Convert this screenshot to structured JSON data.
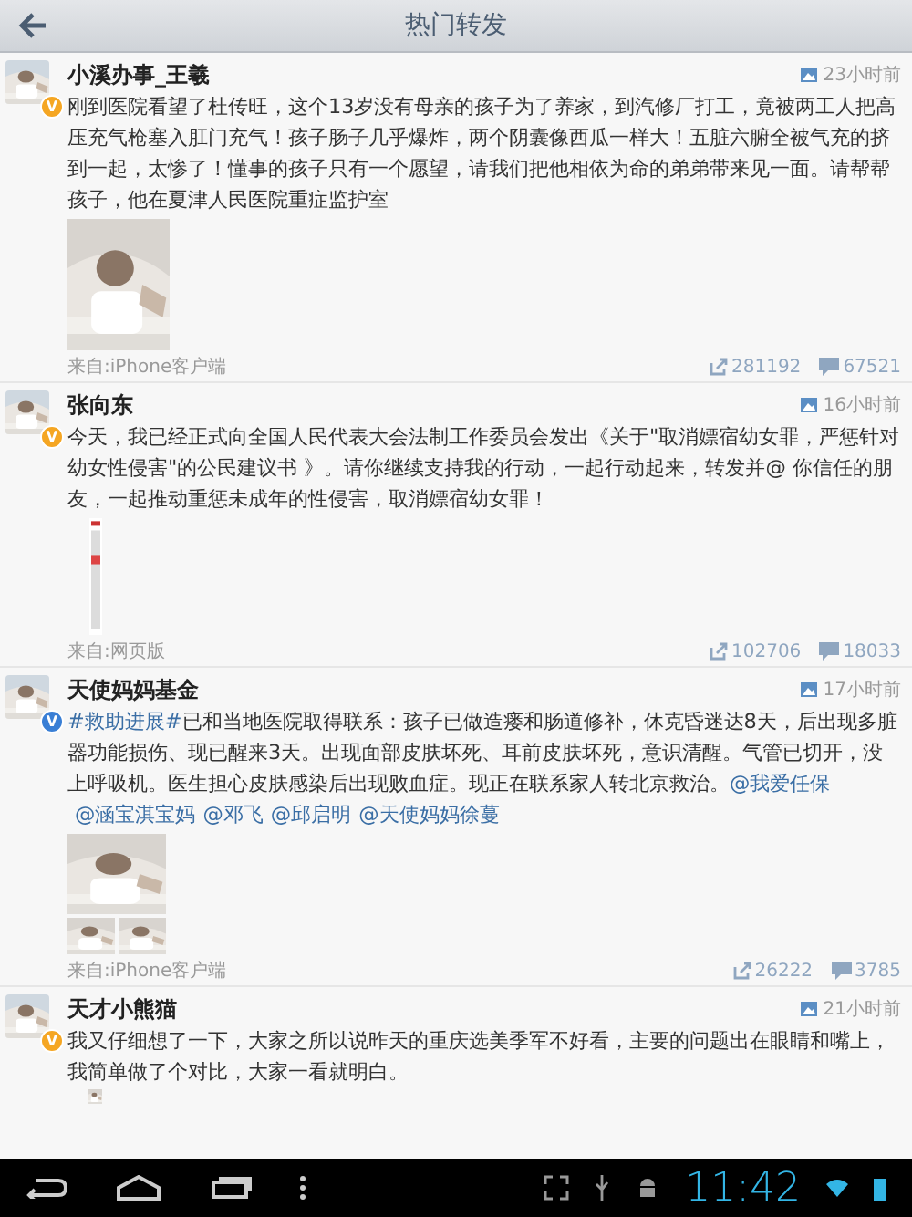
{
  "header": {
    "title": "热门转发"
  },
  "posts": [
    {
      "name": "小溪办事_王羲",
      "badge": {
        "text": "V",
        "color": "#f5a623"
      },
      "time": "23小时前",
      "text": [
        {
          "kind": "plain",
          "text": "刚到医院看望了杜传旺，这个13岁没有母亲的孩子为了养家，到汽修厂打工，竟被两工人把高压充气枪塞入肛门充气！孩子肠子几乎爆炸，两个阴囊像西瓜一样大！五脏六腑全被气充的挤到一起，太惨了！懂事的孩子只有一个愿望，请我们把他相依为命的弟弟带来见一面。请帮帮孩子，他在夏津人民医院重症监护室"
        }
      ],
      "source": "来自:iPhone客户端",
      "reposts": "281192",
      "comments": "67521"
    },
    {
      "name": "张向东",
      "badge": {
        "text": "V",
        "color": "#f5a623"
      },
      "time": "16小时前",
      "text": [
        {
          "kind": "plain",
          "text": "今天，我已经正式向全国人民代表大会法制工作委员会发出《关于\"取消嫖宿幼女罪，严惩针对幼女性侵害\"的公民建议书 》。请你继续支持我的行动，一起行动起来，转发并@ 你信任的朋友，一起推动重惩未成年的性侵害，取消嫖宿幼女罪！"
        }
      ],
      "media": {
        "kind": "document"
      },
      "source": "来自:网页版",
      "reposts": "102706",
      "comments": "18033"
    },
    {
      "name": "天使妈妈基金",
      "badge": {
        "text": "V",
        "color": "#3a7fd5"
      },
      "time": "17小时前",
      "text": [
        {
          "kind": "link",
          "text": "#救助进展#"
        },
        {
          "kind": "plain",
          "text": "已和当地医院取得联系：孩子已做造瘘和肠道修补，休克昏迷达8天，后出现多脏器功能损伤、现已醒来3天。出现面部皮肤坏死、耳前皮肤坏死，意识清醒。气管已切开，没上呼吸机。医生担心皮肤感染后出现败血症。现正在联系家人转北京救治。"
        },
        {
          "kind": "link",
          "text": "@我爱任保"
        },
        {
          "kind": "link",
          "text": "@涵宝淇宝妈"
        },
        {
          "kind": "link",
          "text": "@邓飞"
        },
        {
          "kind": "link",
          "text": "@邱启明"
        },
        {
          "kind": "link",
          "text": "@天使妈妈徐蔓"
        }
      ],
      "media": {
        "kind": "photo_grid"
      },
      "source": "来自:iPhone客户端",
      "reposts": "26222",
      "comments": "3785"
    },
    {
      "name": "天才小熊猫",
      "badge": {
        "text": "V",
        "color": "#f5a623"
      },
      "time": "21小时前",
      "text": [
        {
          "kind": "plain",
          "text": "我又仔细想了一下，大家之所以说昨天的重庆选美季军不好看，主要的问题出在眼睛和嘴上，我简单做了个对比，大家一看就明白。"
        }
      ],
      "media": {
        "kind": "thumb"
      }
    }
  ],
  "navbar": {
    "clock": "11:42"
  }
}
